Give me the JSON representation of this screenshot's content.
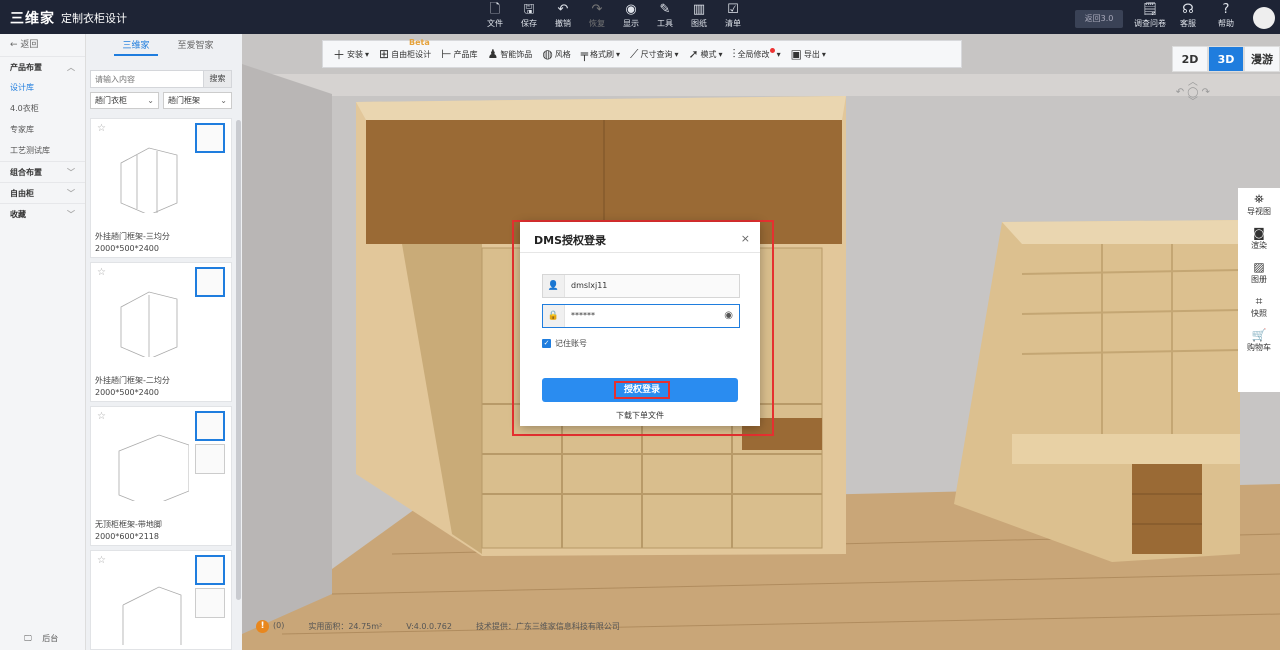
{
  "app": {
    "logo": "三维家",
    "title": "定制衣柜设计"
  },
  "top_menu": [
    {
      "icon": "file-icon",
      "label": "文件"
    },
    {
      "icon": "save-icon",
      "label": "保存"
    },
    {
      "icon": "undo-icon",
      "label": "撤销"
    },
    {
      "icon": "redo-icon",
      "label": "恢复"
    },
    {
      "icon": "eye-icon",
      "label": "显示"
    },
    {
      "icon": "tool-icon",
      "label": "工具"
    },
    {
      "icon": "drawing-icon",
      "label": "图纸"
    },
    {
      "icon": "list-icon",
      "label": "清单"
    }
  ],
  "top_right": {
    "back_label": "返回3.0",
    "items": [
      {
        "icon": "survey-icon",
        "label": "调查问卷"
      },
      {
        "icon": "service-icon",
        "label": "客服"
      },
      {
        "icon": "help-icon",
        "label": "帮助"
      }
    ]
  },
  "leftnav": {
    "back": "返回",
    "groups": [
      {
        "label": "产品布置",
        "items": [
          "设计库",
          "4.0衣柜",
          "专家库",
          "工艺测试库"
        ]
      },
      {
        "label": "组合布置",
        "items": []
      },
      {
        "label": "自由柜",
        "items": []
      },
      {
        "label": "收藏",
        "items": []
      }
    ],
    "bottom": "后台"
  },
  "panel": {
    "tabs": [
      "三维家",
      "至爱智家"
    ],
    "search_placeholder": "请输入内容",
    "search_button": "搜索",
    "filter1": "趟门衣柜",
    "filter2": "趟门框架",
    "cards": [
      {
        "name": "外挂趟门框架-三均分",
        "size": "2000*500*2400"
      },
      {
        "name": "外挂趟门框架-二均分",
        "size": "2000*500*2400"
      },
      {
        "name": "无顶柜框架-带地脚",
        "size": "2000*600*2118"
      },
      {
        "name": "",
        "size": ""
      }
    ]
  },
  "toolbar": [
    {
      "icon": "plus-icon",
      "label": "安装"
    },
    {
      "icon": "cabinet-icon",
      "label": "自由柜设计"
    },
    {
      "icon": "product-icon",
      "label": "产品库"
    },
    {
      "icon": "decor-icon",
      "label": "智能饰品"
    },
    {
      "icon": "palette-icon",
      "label": "风格"
    },
    {
      "icon": "brush-icon",
      "label": "格式刷"
    },
    {
      "icon": "ruler-icon",
      "label": "尺寸查询"
    },
    {
      "icon": "cursor-icon",
      "label": "模式"
    },
    {
      "icon": "sliders-icon",
      "label": "全局修改"
    },
    {
      "icon": "export-icon",
      "label": "导出"
    }
  ],
  "beta_tag": "Beta",
  "view_switch": [
    "2D",
    "3D",
    "漫游"
  ],
  "rightbar": [
    {
      "icon": "navigation-icon",
      "label": "导视图"
    },
    {
      "icon": "camera-icon",
      "label": "渲染"
    },
    {
      "icon": "gallery-icon",
      "label": "图册"
    },
    {
      "icon": "snapshot-icon",
      "label": "快照"
    },
    {
      "icon": "cart-icon",
      "label": "购物车"
    }
  ],
  "status": {
    "warn_count": "(0)",
    "area": "实用面积：24.75m²",
    "version": "V:4.0.0.762",
    "provider": "技术提供：广东三维家信息科技有限公司"
  },
  "modal": {
    "title": "DMS授权登录",
    "username": "dmslxj11",
    "password_mask": "******",
    "remember": "记住账号",
    "login": "授权登录",
    "download": "下载下单文件"
  },
  "colors": {
    "accent": "#1f7dde",
    "highlight": "#e53030",
    "topbar": "#1e2435"
  }
}
